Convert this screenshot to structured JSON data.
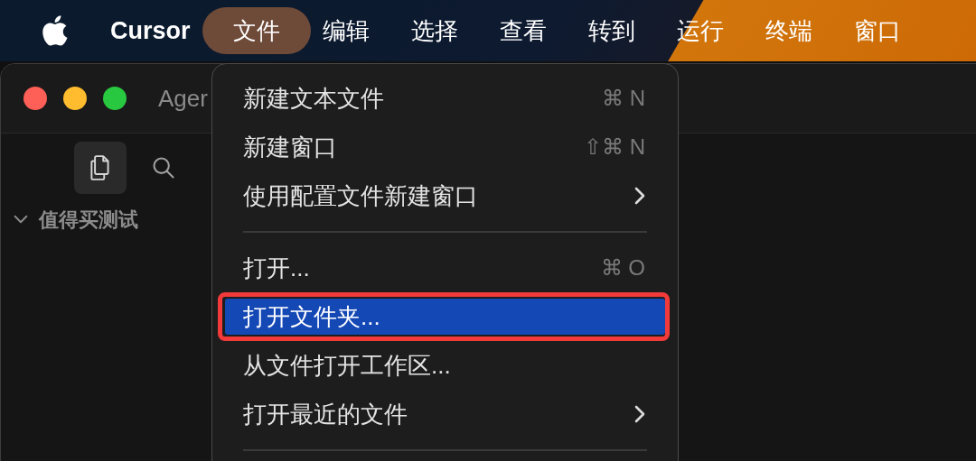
{
  "menu_bar": {
    "app_name": "Cursor",
    "menus": [
      {
        "label": "文件",
        "selected": true
      },
      {
        "label": "编辑",
        "selected": false
      },
      {
        "label": "选择",
        "selected": false
      },
      {
        "label": "查看",
        "selected": false
      },
      {
        "label": "转到",
        "selected": false
      },
      {
        "label": "运行",
        "selected": false
      },
      {
        "label": "终端",
        "selected": false
      },
      {
        "label": "窗口",
        "selected": false
      }
    ]
  },
  "window": {
    "title": "Ager",
    "sidebar": {
      "tools": [
        {
          "kind": "files",
          "selected": true
        },
        {
          "kind": "search",
          "selected": false
        }
      ],
      "tree": [
        {
          "label": "值得买测试",
          "expanded": true
        }
      ]
    }
  },
  "dropdown_menu": {
    "items": [
      {
        "kind": "item",
        "label": "新建文本文件",
        "shortcut": "⌘ N",
        "submenu": false,
        "selected": false,
        "annotated": false
      },
      {
        "kind": "item",
        "label": "新建窗口",
        "shortcut": "⇧⌘ N",
        "submenu": false,
        "selected": false,
        "annotated": false
      },
      {
        "kind": "item",
        "label": "使用配置文件新建窗口",
        "submenu": true,
        "selected": false,
        "annotated": false
      },
      {
        "kind": "separator"
      },
      {
        "kind": "item",
        "label": "打开...",
        "shortcut": "⌘ O",
        "submenu": false,
        "selected": false,
        "annotated": false
      },
      {
        "kind": "item",
        "label": "打开文件夹...",
        "submenu": false,
        "selected": true,
        "annotated": true
      },
      {
        "kind": "item",
        "label": "从文件打开工作区...",
        "submenu": false,
        "selected": false,
        "annotated": false
      },
      {
        "kind": "item",
        "label": "打开最近的文件",
        "submenu": true,
        "selected": false,
        "annotated": false
      },
      {
        "kind": "separator"
      }
    ]
  }
}
